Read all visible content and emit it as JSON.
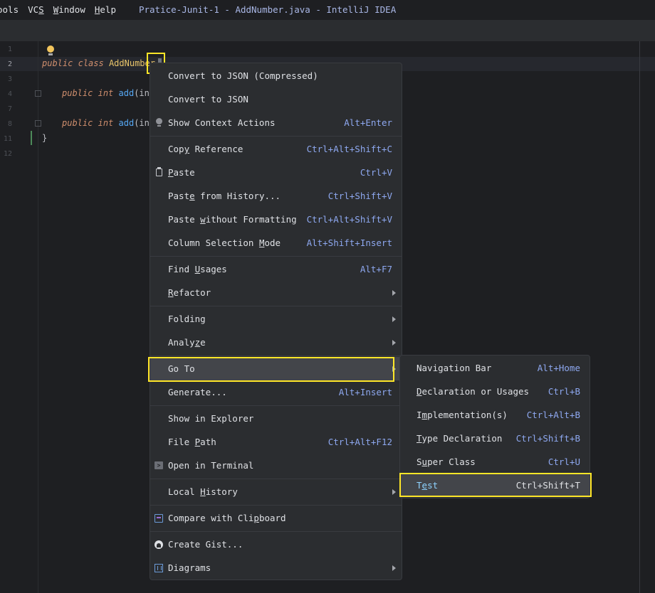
{
  "menubar": {
    "items": [
      {
        "pre": "",
        "u": "",
        "post": "ools"
      },
      {
        "pre": "VC",
        "u": "S",
        "post": ""
      },
      {
        "pre": "",
        "u": "W",
        "post": "indow"
      },
      {
        "pre": "",
        "u": "H",
        "post": "elp"
      }
    ],
    "window_title": "Pratice-Junit-1 - AddNumber.java - IntelliJ IDEA"
  },
  "editor": {
    "line_numbers": [
      "1",
      "2",
      "3",
      "4",
      "7",
      "8",
      "11",
      "12"
    ],
    "line2": {
      "kw1": "public",
      "kw2": "class",
      "cls": "AddNumber"
    },
    "line4": {
      "kw1": "public",
      "kw2": "int",
      "fn": "add",
      "rest": "(int"
    },
    "line8": {
      "kw1": "public",
      "kw2": "int",
      "fn": "add",
      "rest": "(int"
    },
    "line11": "}"
  },
  "context_menu": {
    "items": [
      {
        "name": "convert-json-compressed",
        "pre": "Convert to JSON (Compressed)",
        "u": "",
        "post": "",
        "shortcut": "",
        "submenu": false,
        "icon": ""
      },
      {
        "name": "convert-json",
        "pre": "Convert to JSON",
        "u": "",
        "post": "",
        "shortcut": "",
        "submenu": false,
        "icon": ""
      },
      {
        "name": "show-context-actions",
        "pre": "Show Context Actions",
        "u": "",
        "post": "",
        "shortcut": "Alt+Enter",
        "submenu": false,
        "icon": "lightbulb-icon"
      },
      {
        "name": "copy-reference",
        "pre": "Cop",
        "u": "y",
        "post": " Reference",
        "shortcut": "Ctrl+Alt+Shift+C",
        "submenu": false,
        "icon": ""
      },
      {
        "name": "paste",
        "pre": "",
        "u": "P",
        "post": "aste",
        "shortcut": "Ctrl+V",
        "submenu": false,
        "icon": "clipboard-icon"
      },
      {
        "name": "paste-from-history",
        "pre": "Past",
        "u": "e",
        "post": " from History...",
        "shortcut": "Ctrl+Shift+V",
        "submenu": false,
        "icon": ""
      },
      {
        "name": "paste-without-formatting",
        "pre": "Paste ",
        "u": "w",
        "post": "ithout Formatting",
        "shortcut": "Ctrl+Alt+Shift+V",
        "submenu": false,
        "icon": ""
      },
      {
        "name": "column-selection-mode",
        "pre": "Column Selection ",
        "u": "M",
        "post": "ode",
        "shortcut": "Alt+Shift+Insert",
        "submenu": false,
        "icon": ""
      },
      {
        "name": "find-usages",
        "pre": "Find ",
        "u": "U",
        "post": "sages",
        "shortcut": "Alt+F7",
        "submenu": false,
        "icon": ""
      },
      {
        "name": "refactor",
        "pre": "",
        "u": "R",
        "post": "efactor",
        "shortcut": "",
        "submenu": true,
        "icon": ""
      },
      {
        "name": "folding",
        "pre": "Folding",
        "u": "",
        "post": "",
        "shortcut": "",
        "submenu": true,
        "icon": ""
      },
      {
        "name": "analyze",
        "pre": "Analy",
        "u": "z",
        "post": "e",
        "shortcut": "",
        "submenu": true,
        "icon": ""
      },
      {
        "name": "go-to",
        "pre": "Go To",
        "u": "",
        "post": "",
        "shortcut": "",
        "submenu": true,
        "icon": ""
      },
      {
        "name": "generate",
        "pre": "Generate...",
        "u": "",
        "post": "",
        "shortcut": "Alt+Insert",
        "submenu": false,
        "icon": ""
      },
      {
        "name": "show-in-explorer",
        "pre": "Show in Explorer",
        "u": "",
        "post": "",
        "shortcut": "",
        "submenu": false,
        "icon": ""
      },
      {
        "name": "file-path",
        "pre": "File ",
        "u": "P",
        "post": "ath",
        "shortcut": "Ctrl+Alt+F12",
        "submenu": false,
        "icon": ""
      },
      {
        "name": "open-in-terminal",
        "pre": "Open in Terminal",
        "u": "",
        "post": "",
        "shortcut": "",
        "submenu": false,
        "icon": "terminal-icon"
      },
      {
        "name": "local-history",
        "pre": "Local ",
        "u": "H",
        "post": "istory",
        "shortcut": "",
        "submenu": true,
        "icon": ""
      },
      {
        "name": "compare-with-clipboard",
        "pre": "Compare with Cli",
        "u": "p",
        "post": "board",
        "shortcut": "",
        "submenu": false,
        "icon": "compare-icon"
      },
      {
        "name": "create-gist",
        "pre": "Create Gist...",
        "u": "",
        "post": "",
        "shortcut": "",
        "submenu": false,
        "icon": "github-icon"
      },
      {
        "name": "diagrams",
        "pre": "Diagrams",
        "u": "",
        "post": "",
        "shortcut": "",
        "submenu": true,
        "icon": "diagram-icon"
      }
    ]
  },
  "goto_submenu": {
    "items": [
      {
        "name": "navigation-bar",
        "pre": "Navigation Bar",
        "u": "",
        "post": "",
        "shortcut": "Alt+Home"
      },
      {
        "name": "declaration-or-usages",
        "pre": "",
        "u": "D",
        "post": "eclaration or Usages",
        "shortcut": "Ctrl+B"
      },
      {
        "name": "implementations",
        "pre": "I",
        "u": "m",
        "post": "plementation(s)",
        "shortcut": "Ctrl+Alt+B"
      },
      {
        "name": "type-declaration",
        "pre": "",
        "u": "T",
        "post": "ype Declaration",
        "shortcut": "Ctrl+Shift+B"
      },
      {
        "name": "super-class",
        "pre": "S",
        "u": "u",
        "post": "per Class",
        "shortcut": "Ctrl+U"
      },
      {
        "name": "test",
        "pre": "T",
        "u": "e",
        "post": "st",
        "shortcut": "Ctrl+Shift+T"
      }
    ]
  },
  "colors": {
    "highlight_box": "#ffe628",
    "menu_bg": "#2b2d30",
    "selected_bg": "#43454a",
    "shortcut": "#8ea8f0"
  }
}
